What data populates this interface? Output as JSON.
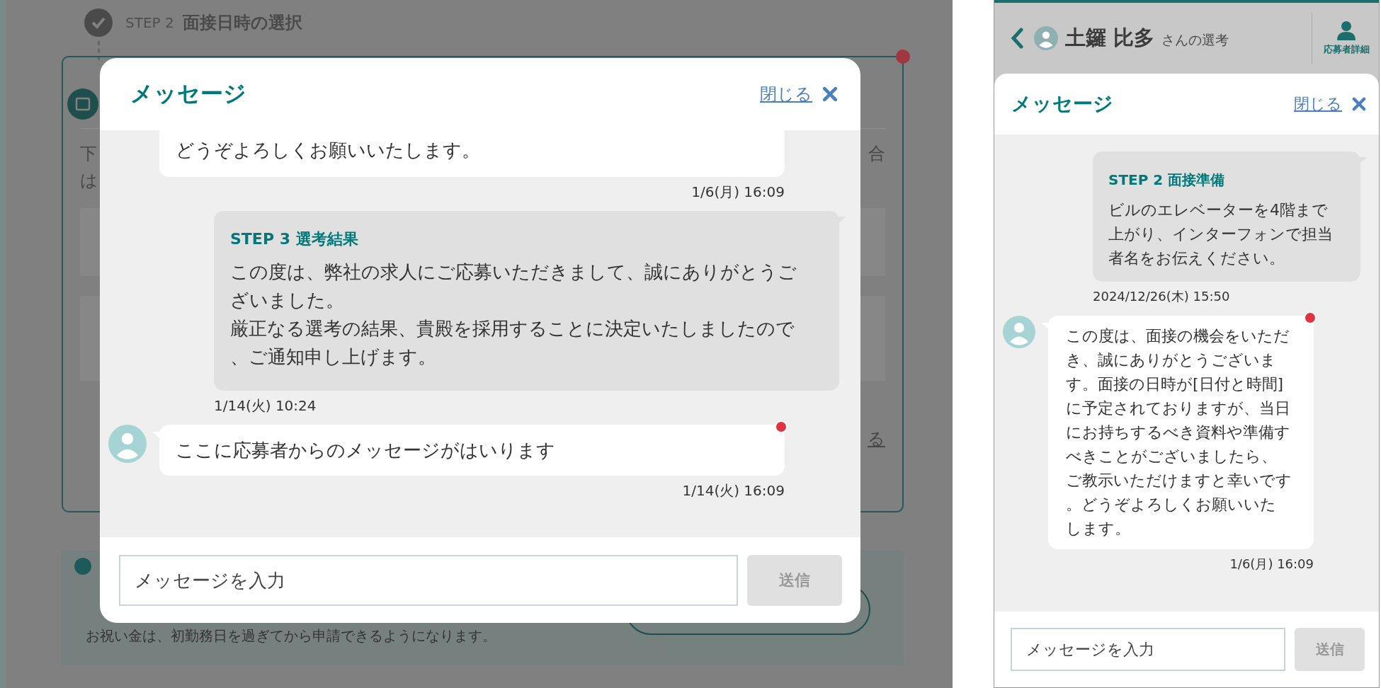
{
  "desktop": {
    "background": {
      "step_label": "STEP 2",
      "step_title": "面接日時の選択",
      "card_unread": true,
      "card_fragments": [
        "下",
        "は",
        "合"
      ],
      "card_link": "る",
      "notice": "お祝い金は、初勤務日を過ぎてから申請できるようになります。"
    },
    "modal": {
      "title": "メッセージ",
      "close_label": "閉じる",
      "messages": [
        {
          "kind": "received",
          "cut_top": true,
          "text": "どうぞよろしくお願いいたします。",
          "time": "1/6(月) 16:09",
          "unread": false
        },
        {
          "kind": "sent",
          "heading": "STEP 3 選考結果",
          "text": "この度は、弊社の求人にご応募いただきまして、誠にありがとうございました。",
          "text_2": "厳正なる選考の結果、貴殿を採用することに決定いたしましたので、ご通知申し上げます。",
          "time": "1/14(火) 10:24"
        },
        {
          "kind": "received",
          "cut_top": false,
          "text": "ここに応募者からのメッセージがはいります",
          "time": "1/14(火) 16:09",
          "unread": true
        }
      ],
      "input": {
        "placeholder": "メッセージを入力"
      },
      "send_button": {
        "label": "送信",
        "disabled": true
      }
    }
  },
  "mobile": {
    "header": {
      "name": "土鑼 比多",
      "suffix": "さんの選考",
      "details_label": "応募者詳細"
    },
    "modal": {
      "title": "メッセージ",
      "close_label": "閉じる",
      "messages": [
        {
          "kind": "sent",
          "heading": "STEP 2 面接準備",
          "text": "ビルのエレベーターを4階まで上がり、インターフォンで担当者名をお伝えください。",
          "time": "2024/12/26(木) 15:50"
        },
        {
          "kind": "received",
          "cut_top": false,
          "text": "この度は、面接の機会をいただき、誠にありがとうございます。面接の日時が[日付と時間]に予定されておりますが、当日にお持ちするべき資料や準備すべきことがございましたら、ご教示いただけますと幸いです。どうぞよろしくお願いいたします。",
          "time": "1/6(月) 16:09",
          "unread": true
        }
      ],
      "input": {
        "placeholder": "メッセージを入力"
      },
      "send_button": {
        "label": "送信",
        "disabled": true
      }
    }
  }
}
